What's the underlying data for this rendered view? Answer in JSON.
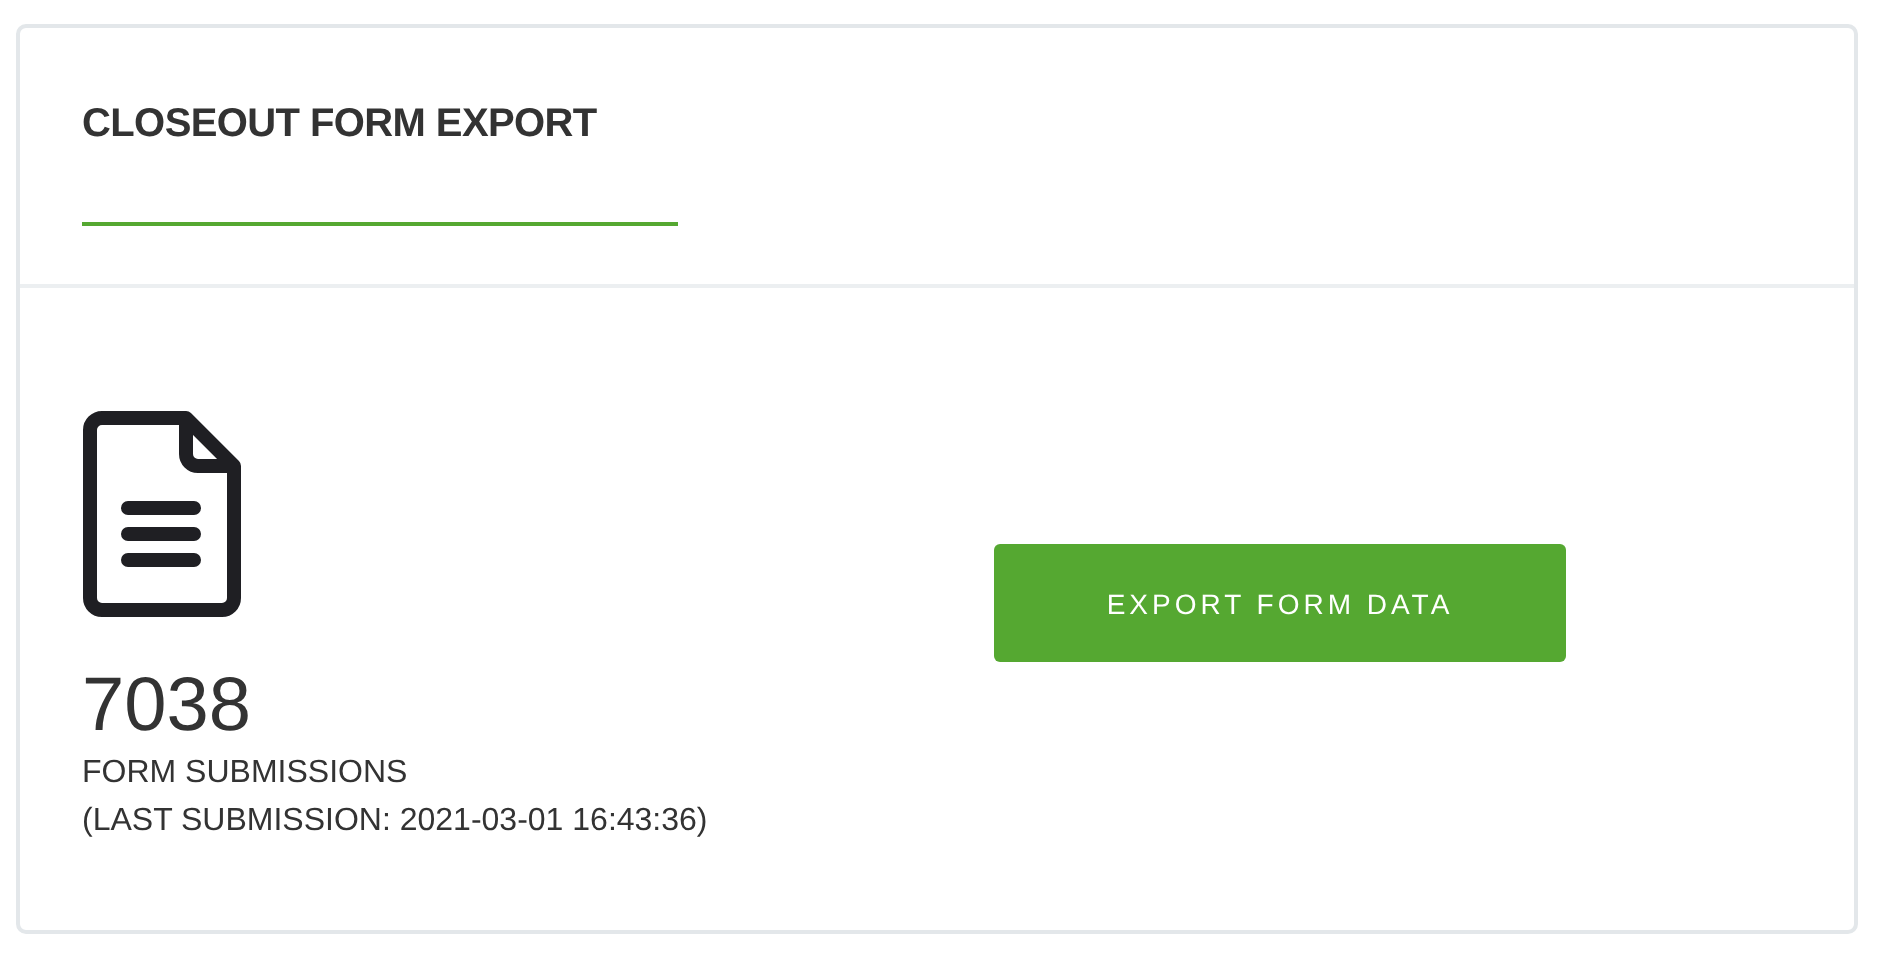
{
  "card": {
    "title": "CLOSEOUT FORM EXPORT",
    "count": "7038",
    "count_label": "FORM SUBMISSIONS",
    "last_submission": "(LAST SUBMISSION: 2021-03-01 16:43:36)",
    "button": "EXPORT FORM DATA"
  }
}
